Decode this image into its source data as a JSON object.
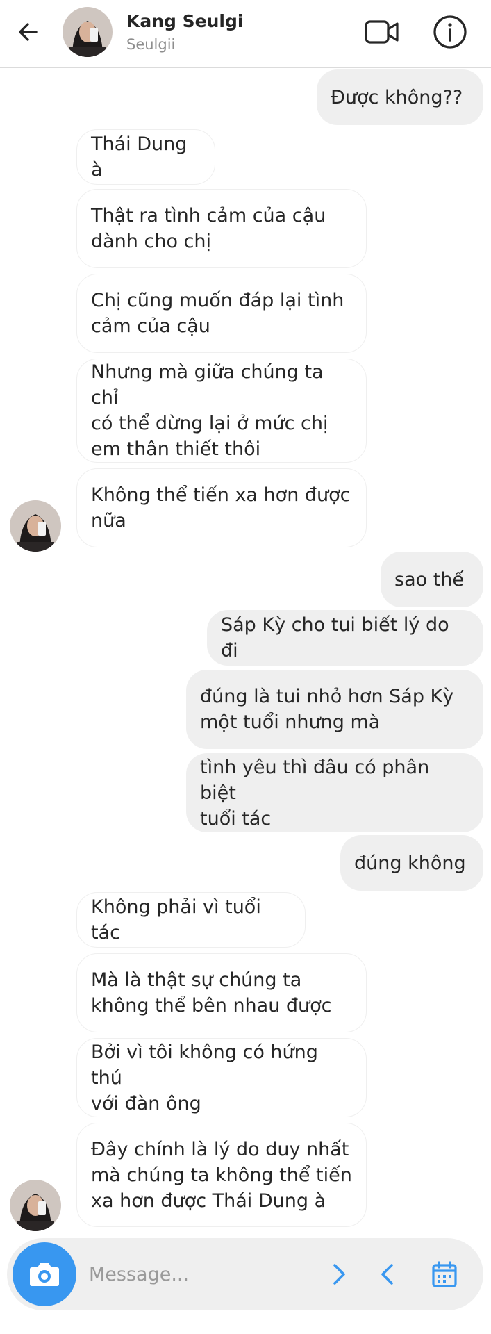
{
  "header": {
    "name": "Kang Seulgi",
    "username": "Seulgii"
  },
  "messages": [
    {
      "from": "me",
      "text": "Được không??"
    },
    {
      "from": "them",
      "text": "Thái Dung à"
    },
    {
      "from": "them",
      "text": "Thật ra tình cảm của cậu\ndành cho chị"
    },
    {
      "from": "them",
      "text": "Chị cũng muốn đáp lại tình\ncảm của cậu"
    },
    {
      "from": "them",
      "text": "Nhưng mà giữa chúng ta chỉ\ncó thể dừng lại ở mức chị\nem thân thiết thôi"
    },
    {
      "from": "them",
      "text": "Không thể tiến xa hơn được\nnữa"
    },
    {
      "from": "me",
      "text": "sao thế"
    },
    {
      "from": "me",
      "text": "Sáp Kỳ cho tui biết lý do đi"
    },
    {
      "from": "me",
      "text": "đúng là tui nhỏ hơn Sáp Kỳ\nmột tuổi nhưng mà"
    },
    {
      "from": "me",
      "text": "tình yêu thì đâu có phân biệt\ntuổi tác"
    },
    {
      "from": "me",
      "text": "đúng không"
    },
    {
      "from": "them",
      "text": "Không phải vì tuổi tác"
    },
    {
      "from": "them",
      "text": "Mà là thật sự chúng ta\nkhông thể bên nhau được"
    },
    {
      "from": "them",
      "text": "Bởi vì tôi không có hứng thú\nvới đàn ông"
    },
    {
      "from": "them",
      "text": "Đây chính là lý do duy nhất\nmà chúng ta không thể tiến\nxa hơn được Thái Dung à"
    }
  ],
  "composer": {
    "placeholder": "Message..."
  },
  "icons": {
    "back": "arrow-left-icon",
    "video": "video-camera-icon",
    "info": "info-icon",
    "camera": "camera-icon",
    "next": "chevron-right-icon",
    "prev": "chevron-left-icon",
    "calendar": "calendar-icon"
  },
  "colors": {
    "accent": "#3897f0",
    "outgoing_bubble": "#efefef",
    "incoming_border": "#efefef"
  }
}
